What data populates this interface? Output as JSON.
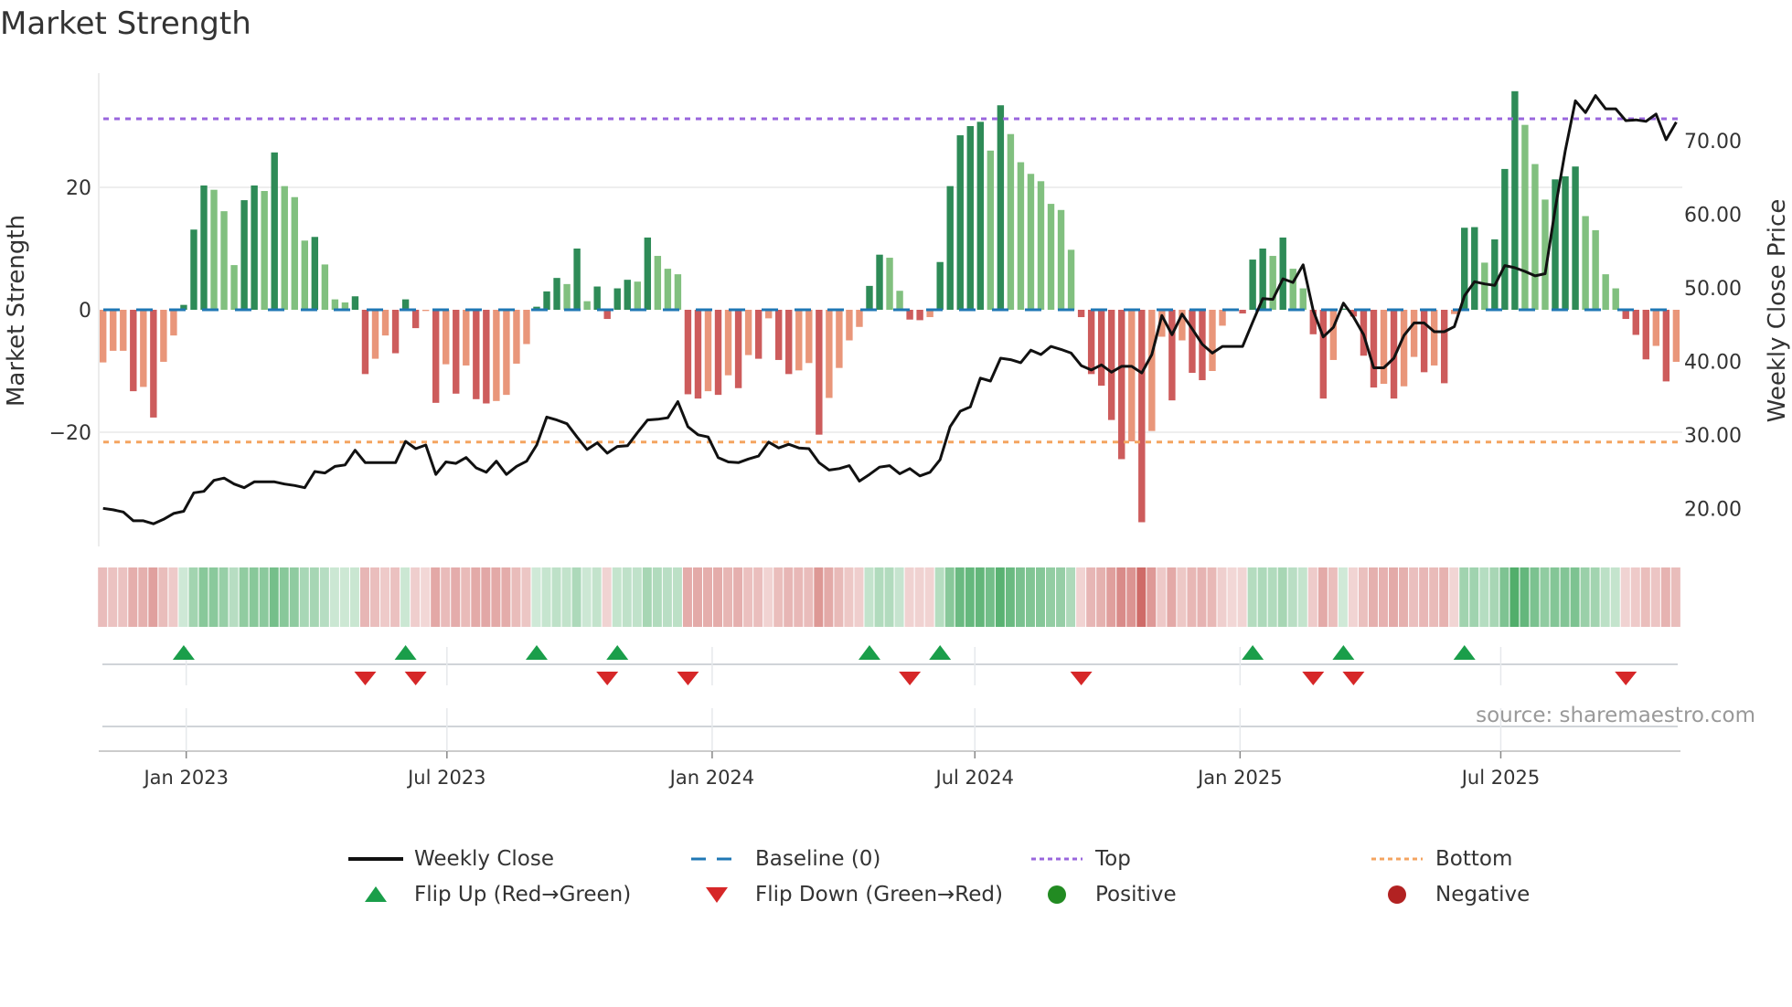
{
  "title": "Market Strength",
  "source": "source: sharemaestro.com",
  "colors": {
    "green_strong": "#2e8b57",
    "green_weak": "#81c07f",
    "red_strong": "#cd5c5c",
    "red_weak": "#e9967a",
    "baseline": "#1f77b4",
    "top": "#9966dd",
    "bottom": "#f4a460",
    "price_line": "#111111",
    "flip_up": "#1a9e4a",
    "flip_down": "#d62728",
    "positive": "#228b22",
    "negative": "#b22222"
  },
  "legend": {
    "weekly_close": "Weekly Close",
    "baseline": "Baseline (0)",
    "top": "Top",
    "bottom": "Bottom",
    "flip_up": "Flip Up (Red→Green)",
    "flip_down": "Flip Down (Green→Red)",
    "positive": "Positive",
    "negative": "Negative"
  },
  "chart_data": {
    "type": "bar",
    "title": "Market Strength",
    "ylabel": "Market Strength",
    "y2label": "Weekly Close Price",
    "ylim": [
      -40.5,
      41
    ],
    "y2lim": [
      13.5,
      84.5
    ],
    "y_ticks": [
      {
        "value": 20,
        "label": "20"
      },
      {
        "value": 0,
        "label": "0"
      },
      {
        "value": -20,
        "label": "−20"
      }
    ],
    "y2_ticks": [
      {
        "value": 70,
        "label": "70.00"
      },
      {
        "value": 60,
        "label": "60.00"
      },
      {
        "value": 50,
        "label": "50.00"
      },
      {
        "value": 40,
        "label": "40.00"
      },
      {
        "value": 30,
        "label": "30.00"
      },
      {
        "value": 20,
        "label": "20.00"
      }
    ],
    "x_ticks": [
      {
        "week": 8.25,
        "label": "Jan 2023"
      },
      {
        "week": 34.1,
        "label": "Jul 2023"
      },
      {
        "week": 60.4,
        "label": "Jan 2024"
      },
      {
        "week": 86.45,
        "label": "Jul 2024"
      },
      {
        "week": 112.75,
        "label": "Jan 2025"
      },
      {
        "week": 138.6,
        "label": "Jul 2025"
      }
    ],
    "top_level": 31.2,
    "bottom_level": -21.6,
    "baseline": 0,
    "strength": [
      -8.6,
      -6.7,
      -6.7,
      -13.3,
      -12.6,
      -17.6,
      -8.5,
      -4.2,
      0.8,
      13.1,
      20.3,
      19.6,
      16.1,
      7.3,
      17.9,
      20.3,
      19.4,
      25.7,
      20.2,
      18.4,
      11.3,
      11.9,
      7.4,
      1.7,
      1.2,
      2.2,
      -10.5,
      -8.0,
      -4.2,
      -7.1,
      1.7,
      -3.0,
      -0.2,
      -15.2,
      -8.9,
      -13.7,
      -9.1,
      -14.6,
      -15.3,
      -14.9,
      -13.9,
      -8.8,
      -5.6,
      0.5,
      3.0,
      5.2,
      4.2,
      10.0,
      1.4,
      3.8,
      -1.5,
      3.5,
      4.9,
      4.6,
      11.8,
      8.8,
      6.7,
      5.8,
      -13.8,
      -14.5,
      -13.3,
      -13.9,
      -10.7,
      -12.8,
      -7.4,
      -8.0,
      -1.4,
      -8.2,
      -10.5,
      -9.9,
      -8.7,
      -20.4,
      -14.4,
      -9.5,
      -5.0,
      -2.8,
      3.9,
      9.0,
      8.5,
      3.1,
      -1.6,
      -1.7,
      -1.2,
      7.8,
      20.2,
      28.5,
      30.0,
      30.7,
      26.0,
      33.4,
      28.7,
      24.1,
      22.2,
      21.0,
      17.3,
      16.3,
      9.8,
      -1.2,
      -10.5,
      -12.4,
      -18.0,
      -24.4,
      -21.5,
      -34.7,
      -19.8,
      -4.4,
      -14.8,
      -5.0,
      -10.3,
      -11.5,
      -10.0,
      -2.6,
      -0.2,
      -0.6,
      8.2,
      10.0,
      8.8,
      11.8,
      6.7,
      3.5,
      -4.0,
      -14.5,
      -8.2,
      0.2,
      -1.1,
      -7.5,
      -12.7,
      -12.1,
      -14.5,
      -12.5,
      -7.7,
      -10.2,
      -9.1,
      -12.0,
      -0.7,
      13.4,
      13.5,
      7.7,
      11.5,
      23.0,
      35.7,
      30.2,
      23.8,
      18.0,
      21.3,
      21.8,
      23.4,
      15.3,
      13.0,
      5.8,
      3.5,
      -1.5,
      -4.1,
      -8.1,
      -5.9,
      -11.7,
      -8.5
    ],
    "weekly_close": [
      20.0,
      19.8,
      19.5,
      18.3,
      18.3,
      17.9,
      18.5,
      19.3,
      19.6,
      22.1,
      22.3,
      23.8,
      24.1,
      23.3,
      22.8,
      23.6,
      23.6,
      23.6,
      23.3,
      23.1,
      22.8,
      25.0,
      24.8,
      25.7,
      25.9,
      27.9,
      26.2,
      26.2,
      26.2,
      26.2,
      29.1,
      28.1,
      28.6,
      24.6,
      26.3,
      26.1,
      26.9,
      25.5,
      24.9,
      26.4,
      24.6,
      25.7,
      26.4,
      28.6,
      32.4,
      32.0,
      31.5,
      29.7,
      28.0,
      28.9,
      27.5,
      28.4,
      28.5,
      30.3,
      32.0,
      32.1,
      32.3,
      34.5,
      31.1,
      30.0,
      29.7,
      26.9,
      26.3,
      26.2,
      26.7,
      27.1,
      29.0,
      28.2,
      28.7,
      28.2,
      28.1,
      26.2,
      25.2,
      25.4,
      25.8,
      23.7,
      24.6,
      25.6,
      25.8,
      24.7,
      25.4,
      24.4,
      24.9,
      26.6,
      31.1,
      33.2,
      33.8,
      37.7,
      37.3,
      40.4,
      40.2,
      39.8,
      41.5,
      40.9,
      42.0,
      41.6,
      41.1,
      39.4,
      38.8,
      39.5,
      38.5,
      39.3,
      39.3,
      38.4,
      40.9,
      46.2,
      43.6,
      46.4,
      44.4,
      42.3,
      41.1,
      42.0,
      42.0,
      42.0,
      45.3,
      48.5,
      48.4,
      51.2,
      50.7,
      53.1,
      46.9,
      43.3,
      44.6,
      47.9,
      46.0,
      43.6,
      39.1,
      39.1,
      40.4,
      43.5,
      45.2,
      45.2,
      44.0,
      44.0,
      44.7,
      48.9,
      50.8,
      50.5,
      50.3,
      53.0,
      52.7,
      52.2,
      51.6,
      51.9,
      60.7,
      68.6,
      75.4,
      73.8,
      76.1,
      74.3,
      74.3,
      72.7,
      72.8,
      72.6,
      73.6,
      70.1,
      72.5
    ]
  }
}
